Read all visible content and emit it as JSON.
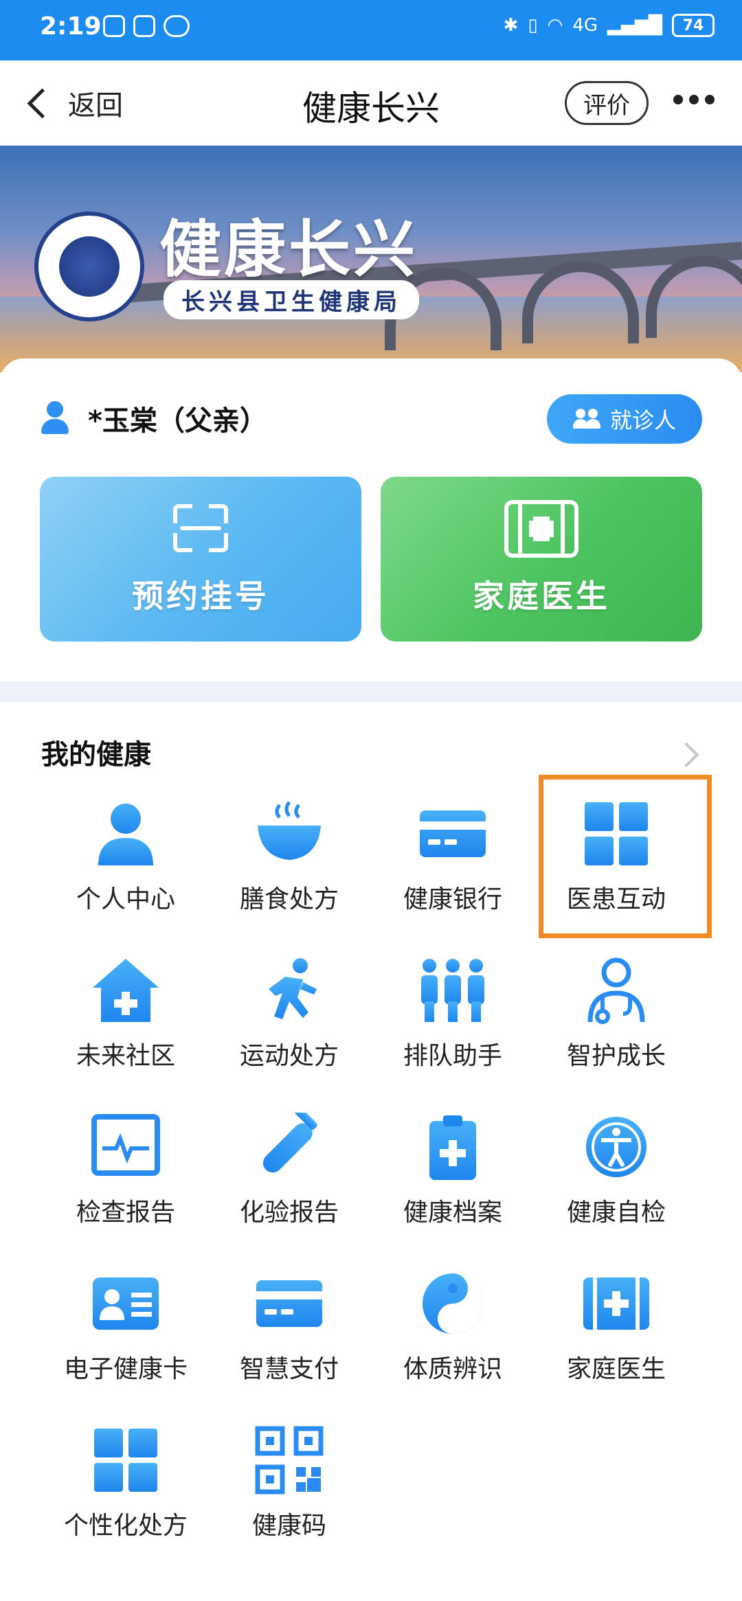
{
  "status_bar": {
    "time": "2:19",
    "network": "4G",
    "battery": "74"
  },
  "nav": {
    "back_label": "返回",
    "title": "健康长兴",
    "rate_label": "评价"
  },
  "banner": {
    "title": "健康长兴",
    "subtitle": "长兴县卫生健康局",
    "seal_text": "长兴县卫生健康局"
  },
  "patient": {
    "name": "*玉棠（父亲）",
    "visitor_button": "就诊人"
  },
  "quick_actions": [
    {
      "label": "预约挂号",
      "icon": "scan-icon"
    },
    {
      "label": "家庭医生",
      "icon": "medkit-icon"
    }
  ],
  "my_health": {
    "title": "我的健康",
    "items": [
      {
        "label": "个人中心",
        "icon": "person-icon"
      },
      {
        "label": "膳食处方",
        "icon": "bowl-icon"
      },
      {
        "label": "健康银行",
        "icon": "card-icon"
      },
      {
        "label": "医患互动",
        "icon": "grid-icon"
      },
      {
        "label": "未来社区",
        "icon": "house-plus-icon"
      },
      {
        "label": "运动处方",
        "icon": "running-icon"
      },
      {
        "label": "排队助手",
        "icon": "queue-icon"
      },
      {
        "label": "智护成长",
        "icon": "doctor-icon"
      },
      {
        "label": "检查报告",
        "icon": "monitor-pulse-icon"
      },
      {
        "label": "化验报告",
        "icon": "test-tube-icon"
      },
      {
        "label": "健康档案",
        "icon": "clipboard-plus-icon"
      },
      {
        "label": "健康自检",
        "icon": "accessibility-icon"
      },
      {
        "label": "电子健康卡",
        "icon": "id-card-icon"
      },
      {
        "label": "智慧支付",
        "icon": "payment-card-icon"
      },
      {
        "label": "体质辨识",
        "icon": "yin-yang-icon"
      },
      {
        "label": "家庭医生",
        "icon": "medkit-icon"
      },
      {
        "label": "个性化处方",
        "icon": "grid-icon"
      },
      {
        "label": "健康码",
        "icon": "qr-code-icon"
      }
    ],
    "highlighted_item": "医患互动"
  },
  "colors": {
    "accent": "#1d8cf0",
    "highlight": "#f08a24",
    "tile_blue": "#5ab8f2",
    "tile_green": "#4cc35f"
  }
}
